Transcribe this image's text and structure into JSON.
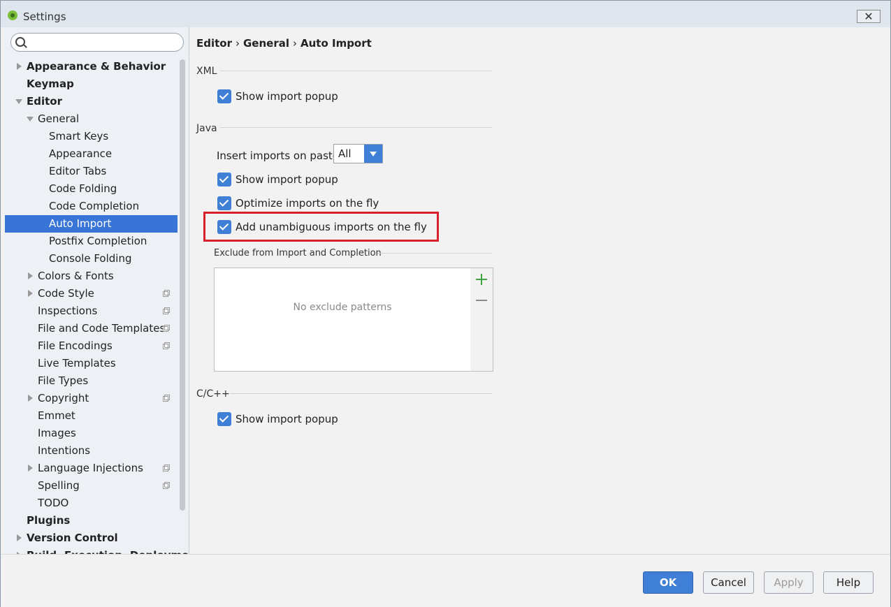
{
  "window": {
    "title": "Settings",
    "close_label": "✕"
  },
  "search": {
    "placeholder": ""
  },
  "tree": [
    {
      "label": "Appearance & Behavior",
      "level": 0,
      "arrow": "right",
      "bold": true
    },
    {
      "label": "Keymap",
      "level": 0,
      "arrow": "",
      "bold": true
    },
    {
      "label": "Editor",
      "level": 0,
      "arrow": "down",
      "bold": true
    },
    {
      "label": "General",
      "level": 1,
      "arrow": "down"
    },
    {
      "label": "Smart Keys",
      "level": 2,
      "arrow": ""
    },
    {
      "label": "Appearance",
      "level": 2,
      "arrow": ""
    },
    {
      "label": "Editor Tabs",
      "level": 2,
      "arrow": ""
    },
    {
      "label": "Code Folding",
      "level": 2,
      "arrow": ""
    },
    {
      "label": "Code Completion",
      "level": 2,
      "arrow": ""
    },
    {
      "label": "Auto Import",
      "level": 2,
      "arrow": "",
      "selected": true
    },
    {
      "label": "Postfix Completion",
      "level": 2,
      "arrow": ""
    },
    {
      "label": "Console Folding",
      "level": 2,
      "arrow": ""
    },
    {
      "label": "Colors & Fonts",
      "level": 1,
      "arrow": "right"
    },
    {
      "label": "Code Style",
      "level": 1,
      "arrow": "right",
      "project": true
    },
    {
      "label": "Inspections",
      "level": 1,
      "arrow": "",
      "project": true
    },
    {
      "label": "File and Code Templates",
      "level": 1,
      "arrow": "",
      "project": true
    },
    {
      "label": "File Encodings",
      "level": 1,
      "arrow": "",
      "project": true
    },
    {
      "label": "Live Templates",
      "level": 1,
      "arrow": ""
    },
    {
      "label": "File Types",
      "level": 1,
      "arrow": ""
    },
    {
      "label": "Copyright",
      "level": 1,
      "arrow": "right",
      "project": true
    },
    {
      "label": "Emmet",
      "level": 1,
      "arrow": ""
    },
    {
      "label": "Images",
      "level": 1,
      "arrow": ""
    },
    {
      "label": "Intentions",
      "level": 1,
      "arrow": ""
    },
    {
      "label": "Language Injections",
      "level": 1,
      "arrow": "right",
      "project": true
    },
    {
      "label": "Spelling",
      "level": 1,
      "arrow": "",
      "project": true
    },
    {
      "label": "TODO",
      "level": 1,
      "arrow": ""
    },
    {
      "label": "Plugins",
      "level": 0,
      "arrow": "",
      "bold": true
    },
    {
      "label": "Version Control",
      "level": 0,
      "arrow": "right",
      "bold": true
    },
    {
      "label": "Build, Execution, Deployment",
      "level": 0,
      "arrow": "right",
      "bold": true
    }
  ],
  "breadcrumb": {
    "part1": "Editor",
    "part2": "General",
    "part3": "Auto Import",
    "sep": "›"
  },
  "xml": {
    "section": "XML",
    "show_popup": "Show import popup"
  },
  "java": {
    "section": "Java",
    "paste_label": "Insert imports on paste:",
    "paste_value": "All",
    "show_popup": "Show import popup",
    "optimize": "Optimize imports on the fly",
    "unambiguous": "Add unambiguous imports on the fly",
    "exclude_label": "Exclude from Import and Completion",
    "exclude_empty": "No exclude patterns"
  },
  "cpp": {
    "section": "C/C++",
    "show_popup": "Show import popup"
  },
  "footer": {
    "ok": "OK",
    "cancel": "Cancel",
    "apply": "Apply",
    "help": "Help"
  },
  "colors": {
    "accent": "#3875d7",
    "highlight": "#d8212b",
    "add": "#3fa33f"
  }
}
